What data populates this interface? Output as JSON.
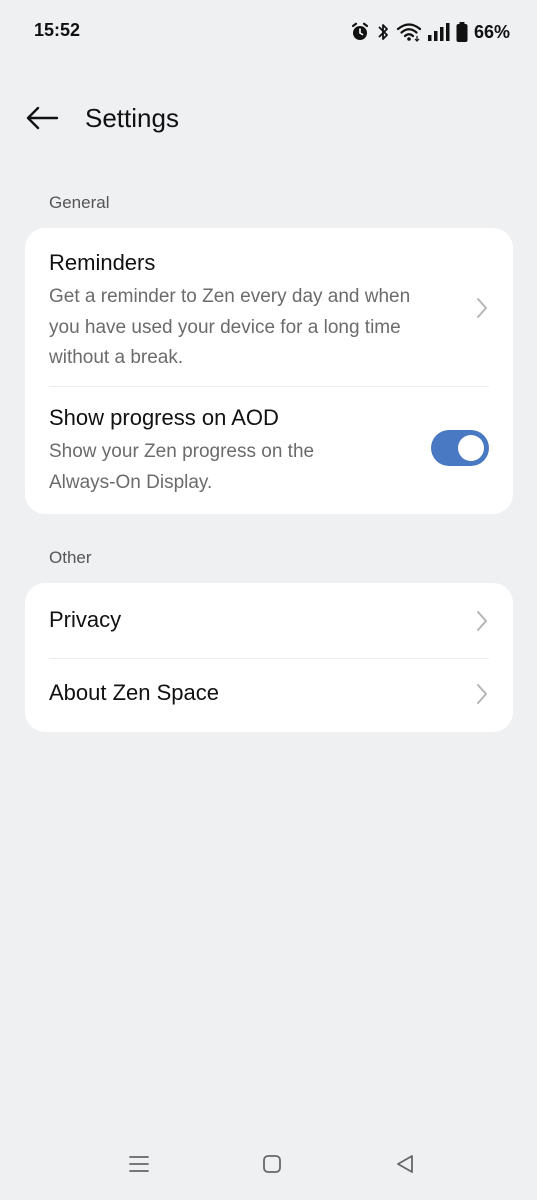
{
  "status_bar": {
    "time": "15:52",
    "battery": "66%",
    "icons": [
      "alarm-icon",
      "bluetooth-icon",
      "wifi-icon",
      "signal-icon",
      "battery-icon"
    ]
  },
  "header": {
    "title": "Settings",
    "back_icon": "back-arrow-icon"
  },
  "sections": {
    "general": {
      "label": "General",
      "reminders": {
        "title": "Reminders",
        "description": "Get a reminder to Zen every day and when you have used your device for a long time without a break."
      },
      "aod": {
        "title": "Show progress on AOD",
        "description": "Show your Zen progress on the Always-On Display.",
        "enabled": true
      }
    },
    "other": {
      "label": "Other",
      "privacy": {
        "title": "Privacy"
      },
      "about": {
        "title": "About Zen Space"
      }
    }
  },
  "nav_bar": {
    "icons": [
      "recents-icon",
      "home-icon",
      "back-icon"
    ]
  },
  "colors": {
    "background": "#eff0f2",
    "card": "#ffffff",
    "accent": "#4a79c4"
  }
}
